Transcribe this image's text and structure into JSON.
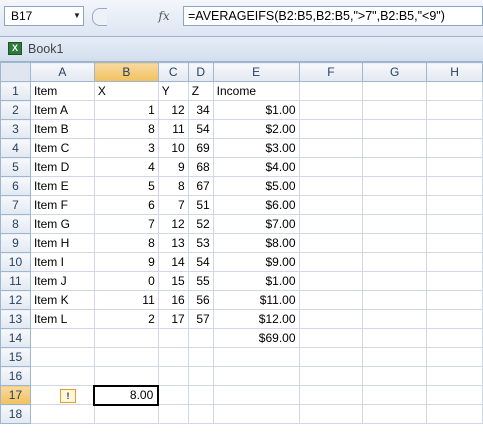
{
  "formula_bar": {
    "name_box": "B17",
    "fx_label": "fx",
    "formula": "=AVERAGEIFS(B2:B5,B2:B5,\">7\",B2:B5,\"<9\")"
  },
  "workbook": {
    "title": "Book1"
  },
  "columns": [
    "A",
    "B",
    "C",
    "D",
    "E",
    "F",
    "G",
    "H"
  ],
  "rows": [
    {
      "num": "1",
      "cells": [
        "Item",
        "X",
        "Y",
        "Z",
        "Income"
      ]
    },
    {
      "num": "2",
      "cells": [
        "Item A",
        "1",
        "12",
        "34",
        "$1.00"
      ]
    },
    {
      "num": "3",
      "cells": [
        "Item B",
        "8",
        "11",
        "54",
        "$2.00"
      ]
    },
    {
      "num": "4",
      "cells": [
        "Item C",
        "3",
        "10",
        "69",
        "$3.00"
      ]
    },
    {
      "num": "5",
      "cells": [
        "Item D",
        "4",
        "9",
        "68",
        "$4.00"
      ]
    },
    {
      "num": "6",
      "cells": [
        "Item E",
        "5",
        "8",
        "67",
        "$5.00"
      ]
    },
    {
      "num": "7",
      "cells": [
        "Item F",
        "6",
        "7",
        "51",
        "$6.00"
      ]
    },
    {
      "num": "8",
      "cells": [
        "Item G",
        "7",
        "12",
        "52",
        "$7.00"
      ]
    },
    {
      "num": "9",
      "cells": [
        "Item H",
        "8",
        "13",
        "53",
        "$8.00"
      ]
    },
    {
      "num": "10",
      "cells": [
        "Item I",
        "9",
        "14",
        "54",
        "$9.00"
      ]
    },
    {
      "num": "11",
      "cells": [
        "Item J",
        "0",
        "15",
        "55",
        "$1.00"
      ]
    },
    {
      "num": "12",
      "cells": [
        "Item K",
        "11",
        "16",
        "56",
        "$11.00"
      ]
    },
    {
      "num": "13",
      "cells": [
        "Item L",
        "2",
        "17",
        "57",
        "$12.00"
      ]
    },
    {
      "num": "14",
      "cells": [
        "",
        "",
        "",
        "",
        "$69.00"
      ]
    },
    {
      "num": "15",
      "cells": [
        "",
        "",
        "",
        "",
        ""
      ]
    },
    {
      "num": "16",
      "cells": [
        "",
        "",
        "",
        "",
        ""
      ]
    },
    {
      "num": "17",
      "cells": [
        "",
        "8.00",
        "",
        "",
        ""
      ]
    },
    {
      "num": "18",
      "cells": [
        "",
        "",
        "",
        "",
        ""
      ]
    }
  ],
  "active_cell": "B17",
  "warning_icon": "error-check-icon"
}
